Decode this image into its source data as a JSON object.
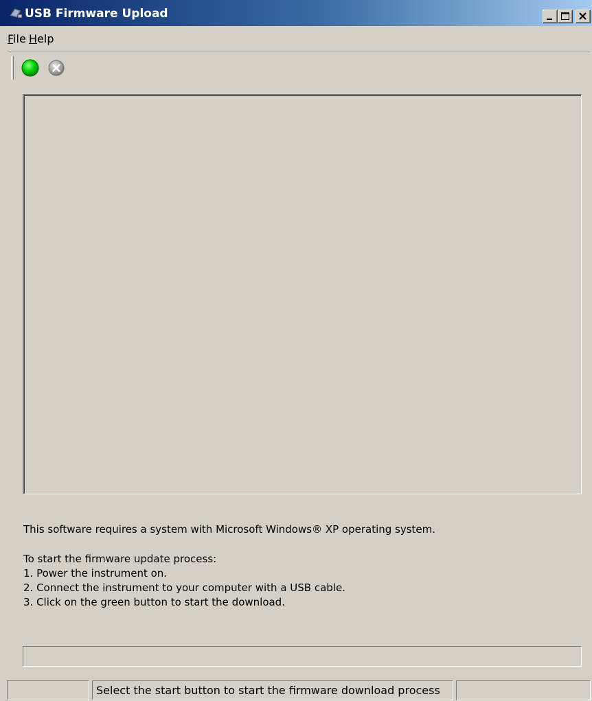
{
  "window": {
    "title": "USB Firmware Upload",
    "icon": "usb-device-icon",
    "controls": [
      "minimize-icon",
      "maximize-icon",
      "close-icon"
    ]
  },
  "menu": {
    "file": {
      "accel": "F",
      "rest": "ile"
    },
    "help": {
      "accel": "H",
      "rest": "elp"
    }
  },
  "toolbar": {
    "start_icon": "green-circle-icon",
    "stop_icon": "cancel-icon",
    "start_color": "#00c800",
    "stop_color": "#a0a0a0"
  },
  "info": {
    "requirement": "This software requires a system with Microsoft Windows® XP operating system.",
    "start_heading": "To start the firmware update process:",
    "steps": [
      "1. Power the instrument on.",
      "2. Connect the instrument to your computer with a USB cable.",
      "3. Click on the green button to start the download."
    ]
  },
  "progress": {
    "value": 0
  },
  "status": {
    "pane1": "",
    "pane2": "Select the start button to start the firmware download process",
    "pane3": ""
  }
}
